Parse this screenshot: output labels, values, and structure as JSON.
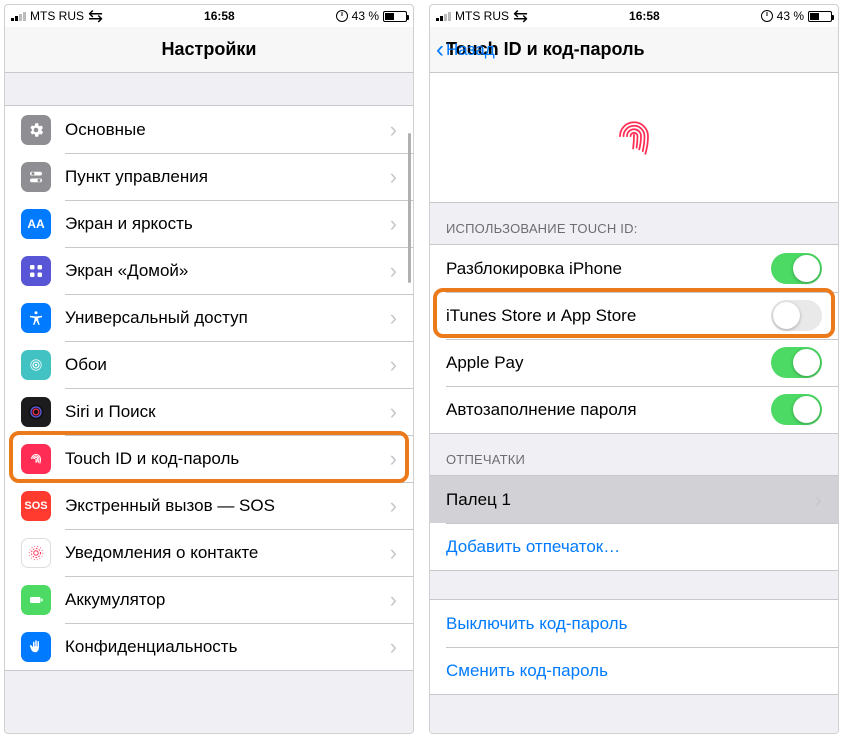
{
  "status": {
    "carrier": "MTS RUS",
    "time": "16:58",
    "battery_pct": "43 %"
  },
  "screen1": {
    "title": "Настройки",
    "items": [
      {
        "label": "Основные"
      },
      {
        "label": "Пункт управления"
      },
      {
        "label": "Экран и яркость"
      },
      {
        "label": "Экран «Домой»"
      },
      {
        "label": "Универсальный доступ"
      },
      {
        "label": "Обои"
      },
      {
        "label": "Siri и Поиск"
      },
      {
        "label": "Touch ID и код-пароль"
      },
      {
        "label": "Экстренный вызов — SOS"
      },
      {
        "label": "Уведомления о контакте"
      },
      {
        "label": "Аккумулятор"
      },
      {
        "label": "Конфиденциальность"
      }
    ]
  },
  "screen2": {
    "back": "Назад",
    "title": "Touch ID и код-пароль",
    "usage_header": "ИСПОЛЬЗОВАНИЕ TOUCH ID:",
    "toggles": [
      {
        "label": "Разблокировка iPhone",
        "on": true
      },
      {
        "label": "iTunes Store и App Store",
        "on": false
      },
      {
        "label": "Apple Pay",
        "on": true
      },
      {
        "label": "Автозаполнение пароля",
        "on": true
      }
    ],
    "fingerprints_header": "ОТПЕЧАТКИ",
    "finger1": "Палец 1",
    "add_finger": "Добавить отпечаток…",
    "turn_off": "Выключить код-пароль",
    "change": "Сменить код-пароль"
  },
  "colors": {
    "highlight": "#eb7a1a",
    "link": "#007aff",
    "toggle_on": "#4cd964"
  }
}
